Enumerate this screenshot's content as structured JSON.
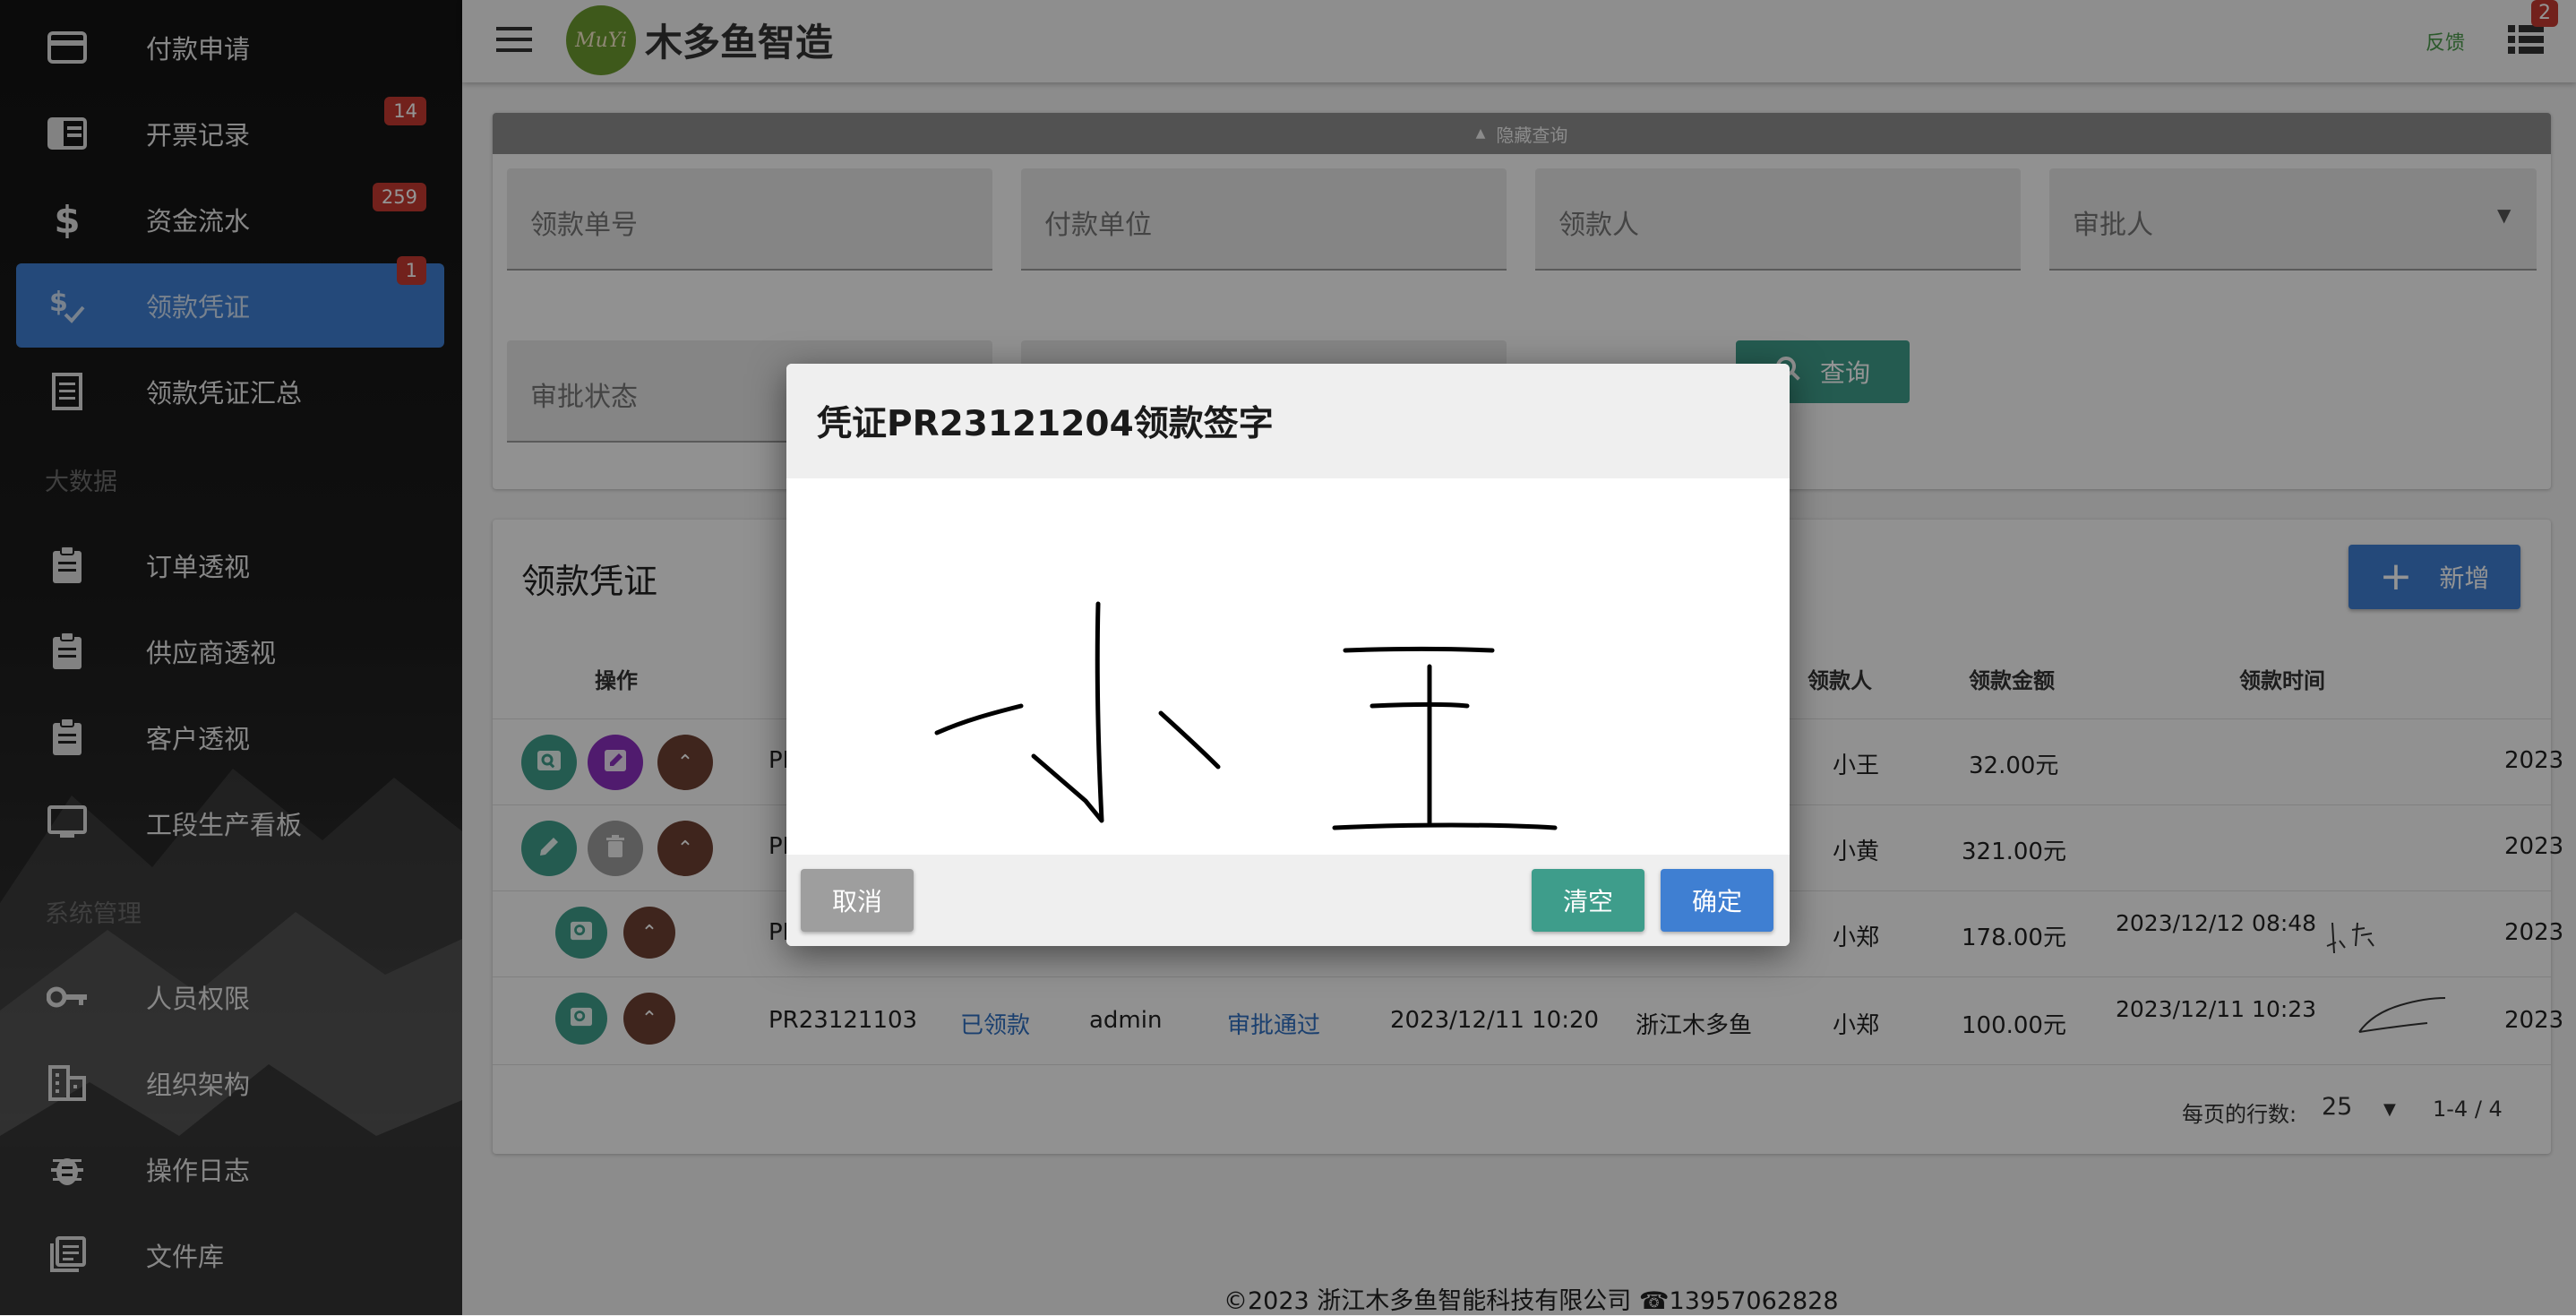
{
  "sidebar": {
    "items": [
      {
        "label": "付款申请",
        "icon": "credit-card-icon"
      },
      {
        "label": "开票记录",
        "icon": "receipt-icon",
        "badge": "14"
      },
      {
        "label": "资金流水",
        "icon": "dollar-icon",
        "badge": "259"
      },
      {
        "label": "领款凭证",
        "icon": "currency-check-icon",
        "badge": "1",
        "active": true
      },
      {
        "label": "领款凭证汇总",
        "icon": "document-icon"
      }
    ],
    "section_bigdata": "大数据",
    "items2": [
      {
        "label": "订单透视",
        "icon": "clipboard-icon"
      },
      {
        "label": "供应商透视",
        "icon": "clipboard-icon"
      },
      {
        "label": "客户透视",
        "icon": "clipboard-icon"
      },
      {
        "label": "工段生产看板",
        "icon": "monitor-icon"
      }
    ],
    "section_system": "系统管理",
    "items3": [
      {
        "label": "人员权限",
        "icon": "key-icon"
      },
      {
        "label": "组织架构",
        "icon": "building-icon"
      },
      {
        "label": "操作日志",
        "icon": "bug-icon"
      },
      {
        "label": "文件库",
        "icon": "library-icon"
      }
    ]
  },
  "header": {
    "logo_text": "MuYi",
    "app_name": "木多鱼智造",
    "feedback": "反馈",
    "notif_badge": "2"
  },
  "search": {
    "toggle_label": "隐藏查询",
    "fields": [
      "领款单号",
      "付款单位",
      "领款人",
      "审批人",
      "审批状态"
    ],
    "query_button": "查询"
  },
  "table": {
    "title": "领款凭证",
    "add_button": "新增",
    "headers": {
      "ops": "操作",
      "payee": "领款人",
      "amount": "领款金额",
      "time": "领款时间"
    },
    "rows": [
      {
        "id": "PR",
        "payee": "小王",
        "amount": "32.00元",
        "time": "",
        "extra": "2023"
      },
      {
        "id": "PR",
        "payee": "小黄",
        "amount": "321.00元",
        "time": "",
        "extra": "2023"
      },
      {
        "id": "PR",
        "payee": "小郑",
        "amount": "178.00元",
        "time": "2023/12/12 08:48",
        "extra": "2023"
      },
      {
        "id": "PR23121103",
        "status": "已领款",
        "user": "admin",
        "approval": "审批通过",
        "date": "2023/12/11 10:20",
        "company": "浙江木多鱼",
        "payee": "小郑",
        "amount": "100.00元",
        "time": "2023/12/11 10:23",
        "extra": "2023"
      }
    ],
    "pagination": {
      "rows_label": "每页的行数:",
      "rows_value": "25",
      "range": "1-4 / 4"
    }
  },
  "footer": {
    "copyright": "©2023 浙江木多鱼智能科技有限公司",
    "phone": "13957062828"
  },
  "dialog": {
    "title": "凭证PR23121204领款签字",
    "cancel": "取消",
    "clear": "清空",
    "confirm": "确定"
  },
  "colors": {
    "primary": "#3f7fd2",
    "teal": "#3e9d8b",
    "grey_button": "#9e9e9e",
    "badge": "#c43a31"
  }
}
